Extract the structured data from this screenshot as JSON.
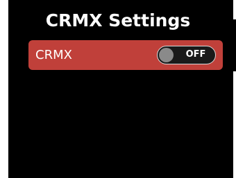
{
  "screen": {
    "title": "CRMX Settings"
  },
  "settings": [
    {
      "label": "CRMX",
      "toggle": {
        "state_text": "OFF",
        "on": false
      }
    }
  ],
  "colors": {
    "background": "#000000",
    "row_background": "#c0403a",
    "toggle_background": "#1a1a1a",
    "toggle_knob": "#8a8a8a",
    "text": "#ffffff"
  }
}
